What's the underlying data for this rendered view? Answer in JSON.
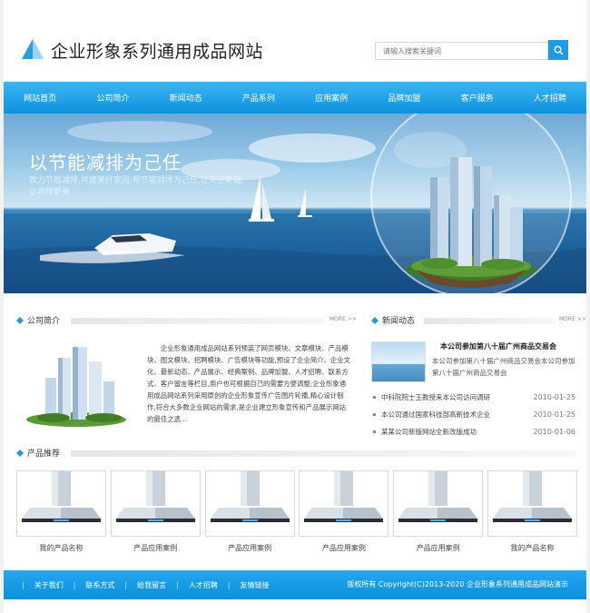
{
  "header": {
    "site_title": "企业形象系列通用成品网站",
    "search_placeholder": "请输入搜索关键词"
  },
  "nav": {
    "items": [
      "网站首页",
      "公司简介",
      "新闻动态",
      "产品系列",
      "应用案例",
      "品牌加盟",
      "客户服务",
      "人才招聘"
    ]
  },
  "banner": {
    "title": "以节能减排为己任",
    "subtitle": "致力节能减排,共建美好家园,视节能减排为己任,让天空更蓝,让地球更美"
  },
  "about": {
    "title": "公司简介",
    "more": "MORE >>",
    "text": "企业形象通用成品网站系列预装了网页模块、文章模块、产品模块、图文模块、招聘模块、广告模块等功能,预设了企业简介、企业文化、最新动态、产品展示、经典案例、品牌加盟、人才招聘、联系方式、客户留言等栏目,用户也可根据自己的需要方便调整;企业形象通用成品网站系列采用原创的企业形象宣传广告图片轮播,精心设计制作,符合大多数企业网站的需求,是企业建立形象宣传和产品展示网站的最佳之选..."
  },
  "news": {
    "title": "新闻动态",
    "more": "MORE >>",
    "headline": "本公司参加第八十届广州商品交易会",
    "summary": "本公司参加第八十届广州商品交易会本公司参加第八十届广州商品交易会",
    "items": [
      {
        "title": "中科院院士王教授来本公司访问调研",
        "date": "2010-01-25"
      },
      {
        "title": "本公司通过国家科技部高新技术企业",
        "date": "2010-01-25"
      },
      {
        "title": "某某公司新版网站全新改版成功",
        "date": "2010-01-06"
      }
    ]
  },
  "products": {
    "title": "产品推荐",
    "items": [
      "我的产品名称",
      "产品应用案例",
      "产品应用案例",
      "产品应用案例",
      "产品应用案例",
      "我的产品名称"
    ]
  },
  "footer": {
    "links": [
      "关于我们",
      "联系方式",
      "给我留言",
      "人才招聘",
      "友情链接"
    ],
    "copyright": "版权所有 Copyright(C)2013-2020 企业形象系列通用成品网站演示"
  },
  "colors": {
    "accent": "#0c92df",
    "nav_light": "#3cb6f3"
  }
}
